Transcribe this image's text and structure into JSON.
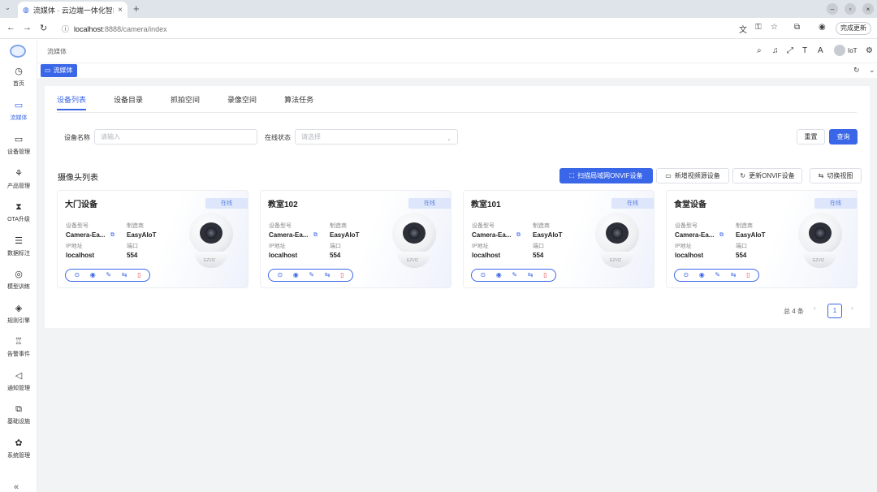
{
  "browser": {
    "tab_title": "流媒体 · 云边端一体化智能",
    "url_host": "localhost",
    "url_path": ":8888/camera/index",
    "update_label": "完成更新",
    "tab_close": "×",
    "new_tab": "+",
    "tab_menu": "⌄"
  },
  "sidebar": {
    "items": [
      {
        "label": "首页",
        "icon": "dashboard-icon",
        "glyph": "◷"
      },
      {
        "label": "流媒体",
        "icon": "video-icon",
        "glyph": "▭"
      },
      {
        "label": "设备管理",
        "icon": "laptop-icon",
        "glyph": "▭"
      },
      {
        "label": "产品管理",
        "icon": "network-icon",
        "glyph": "⚘"
      },
      {
        "label": "OTA升级",
        "icon": "hourglass-icon",
        "glyph": "⧗"
      },
      {
        "label": "数据标注",
        "icon": "database-icon",
        "glyph": "☰"
      },
      {
        "label": "模型训练",
        "icon": "ai-icon",
        "glyph": "◎"
      },
      {
        "label": "规则引擎",
        "icon": "rule-icon",
        "glyph": "◈"
      },
      {
        "label": "告警事件",
        "icon": "alarm-icon",
        "glyph": "♖"
      },
      {
        "label": "通知管理",
        "icon": "megaphone-icon",
        "glyph": "◁"
      },
      {
        "label": "基础设施",
        "icon": "copy-icon",
        "glyph": "⧉"
      },
      {
        "label": "系统管理",
        "icon": "gear-icon",
        "glyph": "✿"
      }
    ],
    "collapse": "«"
  },
  "topbar": {
    "breadcrumb": "流媒体",
    "user": "IoT"
  },
  "tagsbar": {
    "active_tag": "流媒体"
  },
  "tabs": [
    "设备列表",
    "设备目录",
    "抓拍空间",
    "录像空间",
    "算法任务"
  ],
  "filters": {
    "device_name_label": "设备名称",
    "device_name_placeholder": "请输入",
    "status_label": "在线状态",
    "status_placeholder": "请选择",
    "reset": "重置",
    "query": "查询"
  },
  "list": {
    "title": "摄像头列表",
    "actions": {
      "scan": "扫描局域网ONVIF设备",
      "add": "新增视频源设备",
      "update": "更新ONVIF设备",
      "switch": "切换视图"
    },
    "field_labels": {
      "model": "设备型号",
      "maker": "制造商",
      "ip": "IP地址",
      "port": "端口"
    },
    "brand": "EZVIZ",
    "cards": [
      {
        "name": "大门设备",
        "status": "在线",
        "model": "Camera-Ea...",
        "maker": "EasyAIoT",
        "ip": "localhost",
        "port": "554"
      },
      {
        "name": "教室102",
        "status": "在线",
        "model": "Camera-Ea...",
        "maker": "EasyAIoT",
        "ip": "localhost",
        "port": "554"
      },
      {
        "name": "教室101",
        "status": "在线",
        "model": "Camera-Ea...",
        "maker": "EasyAIoT",
        "ip": "localhost",
        "port": "554"
      },
      {
        "name": "食堂设备",
        "status": "在线",
        "model": "Camera-Ea...",
        "maker": "EasyAIoT",
        "ip": "localhost",
        "port": "554"
      }
    ]
  },
  "pagination": {
    "total": "总 4 条",
    "current": "1",
    "prev": "‹",
    "next": "›"
  },
  "colors": {
    "primary": "#3a66e8",
    "danger": "#e84a4a",
    "status_bg": "#dde6fb"
  }
}
